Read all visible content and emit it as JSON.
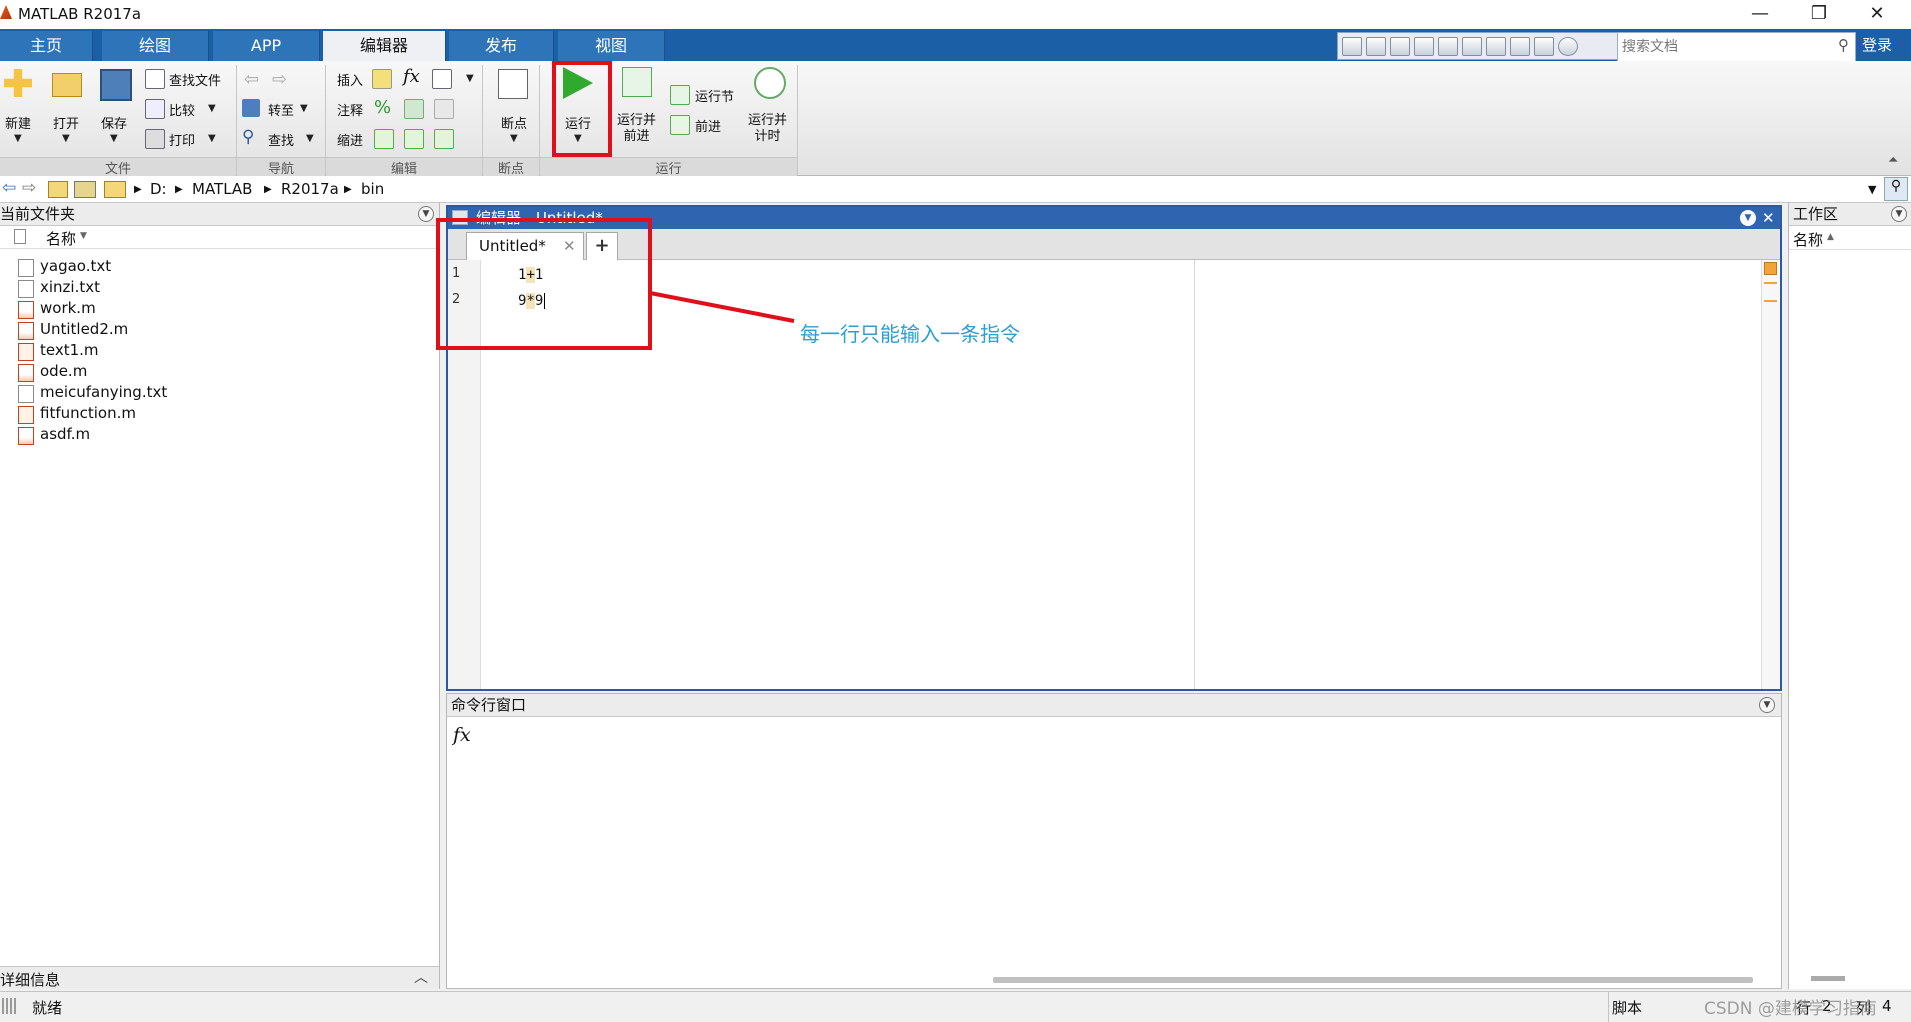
{
  "window": {
    "title": "MATLAB R2017a",
    "controls": [
      "—",
      "❐",
      "✕"
    ]
  },
  "ribbon_tabs": [
    "主页",
    "绘图",
    "APP",
    "编辑器",
    "发布",
    "视图"
  ],
  "active_tab": "编辑器",
  "search": {
    "placeholder": "搜索文档"
  },
  "login_label": "登录",
  "ribbon": {
    "file": {
      "new": "新建",
      "open": "打开",
      "save": "保存",
      "find_files": "查找文件",
      "compare": "比较",
      "print": "打印",
      "group": "文件"
    },
    "navigate": {
      "goto": "转至",
      "find": "查找",
      "group": "导航"
    },
    "edit": {
      "insert": "插入",
      "comment": "注释",
      "indent": "缩进",
      "fx": "fx",
      "percent": "%",
      "group": "编辑"
    },
    "breakpoints": {
      "label": "断点",
      "group": "断点"
    },
    "run": {
      "run": "运行",
      "run_advance": "运行并\n前进",
      "run_section": "运行节",
      "advance": "前进",
      "run_time": "运行并\n计时",
      "group": "运行"
    }
  },
  "address": {
    "drive": "D:",
    "parts": [
      "MATLAB",
      "R2017a",
      "bin"
    ]
  },
  "current_folder": {
    "title": "当前文件夹",
    "column": "名称",
    "files": [
      {
        "name": "yagao.txt",
        "type": "txt"
      },
      {
        "name": "xinzi.txt",
        "type": "txt"
      },
      {
        "name": "work.m",
        "type": "m"
      },
      {
        "name": "Untitled2.m",
        "type": "m"
      },
      {
        "name": "text1.m",
        "type": "fx"
      },
      {
        "name": "ode.m",
        "type": "m"
      },
      {
        "name": "meicufanying.txt",
        "type": "txt"
      },
      {
        "name": "fitfunction.m",
        "type": "fx"
      },
      {
        "name": "asdf.m",
        "type": "m"
      }
    ],
    "details": "详细信息"
  },
  "editor": {
    "header": "编辑器 - Untitled*",
    "tab": "Untitled*",
    "add_tab": "+",
    "lines": [
      {
        "num": "1",
        "pre": "1",
        "op": "+",
        "post": "1"
      },
      {
        "num": "2",
        "pre": "9",
        "op": "*",
        "post": "9"
      }
    ]
  },
  "command_window": {
    "title": "命令行窗口",
    "prompt": "fx"
  },
  "workspace": {
    "title": "工作区",
    "column": "名称"
  },
  "status": {
    "text": "就绪",
    "mode": "脚本",
    "row_label": "行",
    "row": "2",
    "col_label": "列",
    "col": "4"
  },
  "annotation": {
    "text": "每一行只能输入一条指令"
  },
  "watermark": "CSDN @建模学习指南",
  "colors": {
    "accent": "#2e74b9",
    "highlight_red": "#e0101a",
    "annotation_blue": "#2a9fd6"
  }
}
